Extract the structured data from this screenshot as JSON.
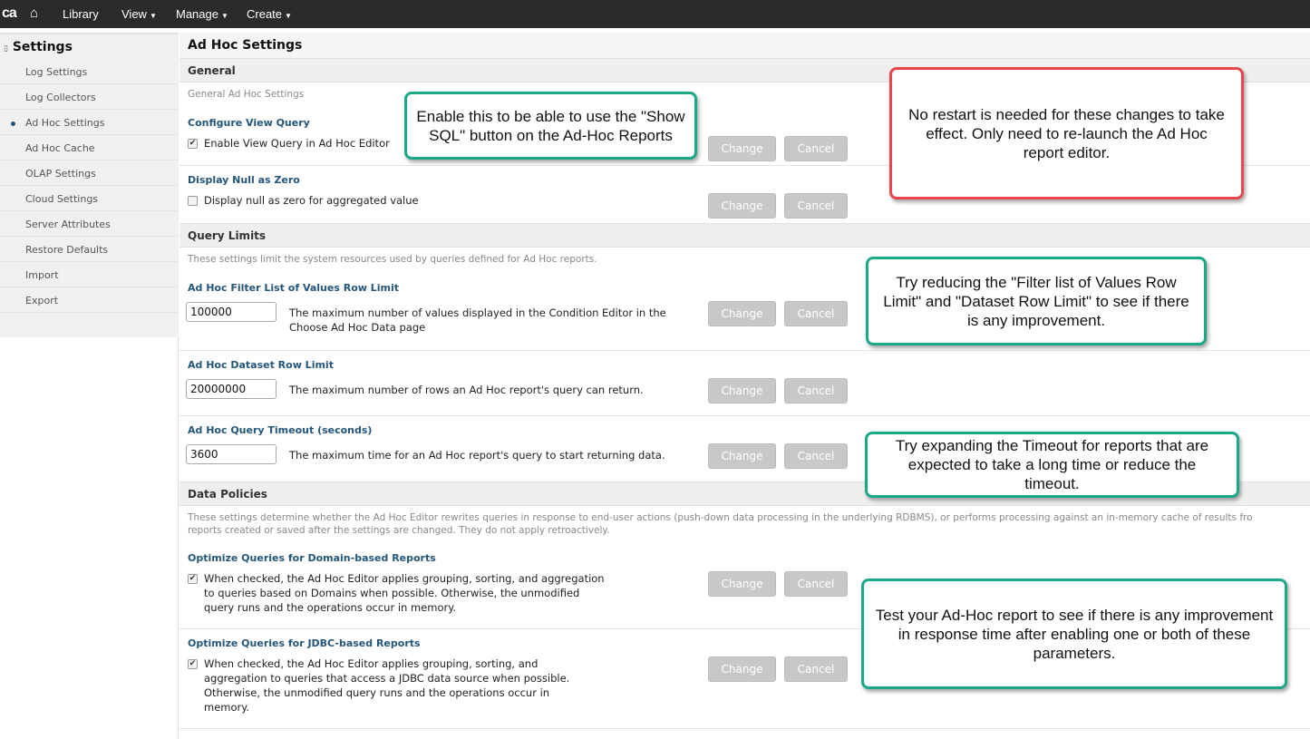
{
  "topbar": {
    "logo": "ca",
    "nav": [
      "Library",
      "View",
      "Manage",
      "Create"
    ]
  },
  "sidebar": {
    "title": "Settings",
    "items": [
      "Log Settings",
      "Log Collectors",
      "Ad Hoc Settings",
      "Ad Hoc Cache",
      "OLAP Settings",
      "Cloud Settings",
      "Server Attributes",
      "Restore Defaults",
      "Import",
      "Export"
    ],
    "active": "Ad Hoc Settings"
  },
  "main": {
    "title": "Ad Hoc Settings",
    "buttons": {
      "change": "Change",
      "cancel": "Cancel"
    },
    "general": {
      "title": "General",
      "desc": "General Ad Hoc Settings",
      "view_query": {
        "label": "Configure View Query",
        "text": "Enable View Query in Ad Hoc Editor",
        "checked": true
      },
      "null_zero": {
        "label": "Display Null as Zero",
        "text": "Display null as zero for aggregated value",
        "checked": false
      }
    },
    "limits": {
      "title": "Query Limits",
      "desc": "These settings limit the system resources used by queries defined for Ad Hoc reports.",
      "filter": {
        "label": "Ad Hoc Filter List of Values Row Limit",
        "value": "100000",
        "text": "The maximum number of values displayed in the Condition Editor in the Choose Ad Hoc Data page"
      },
      "dataset": {
        "label": "Ad Hoc Dataset Row Limit",
        "value": "20000000",
        "text": "The maximum number of rows an Ad Hoc report's query can return."
      },
      "timeout": {
        "label": "Ad Hoc Query Timeout (seconds)",
        "value": "3600",
        "text": "The maximum time for an Ad Hoc report's query to start returning data."
      }
    },
    "policies": {
      "title": "Data Policies",
      "desc1": "These settings determine whether the Ad Hoc Editor rewrites queries in response to end-user actions (push-down data processing in the underlying RDBMS), or performs processing against an in-memory cache of results fro",
      "desc2": "reports created or saved after the settings are changed. They do not apply retroactively.",
      "domain": {
        "label": "Optimize Queries for Domain-based Reports",
        "text": "When checked, the Ad Hoc Editor applies grouping, sorting, and aggregation to queries based on Domains when possible. Otherwise, the unmodified query runs and the operations occur in memory.",
        "checked": true
      },
      "jdbc": {
        "label": "Optimize Queries for JDBC-based Reports",
        "text": "When checked, the Ad Hoc Editor applies grouping, sorting, and aggregation to queries that access a JDBC data source when possible. Otherwise, the unmodified query runs and the operations occur in memory.",
        "checked": true
      }
    }
  },
  "callouts": {
    "show_sql": "Enable this to be able to use the \"Show SQL\" button on the Ad-Hoc Reports",
    "restart": "No restart is needed for these changes to take effect.  Only need to re-launch the Ad Hoc report editor.",
    "limits": "Try reducing the \"Filter list of Values Row Limit\" and \"Dataset Row Limit\" to see if there is any improvement.",
    "timeout": "Try expanding the Timeout for reports that are expected to take a long time or reduce the timeout.",
    "test": "Test your Ad-Hoc report to see if there is any improvement in response time after enabling one or both of these parameters."
  }
}
